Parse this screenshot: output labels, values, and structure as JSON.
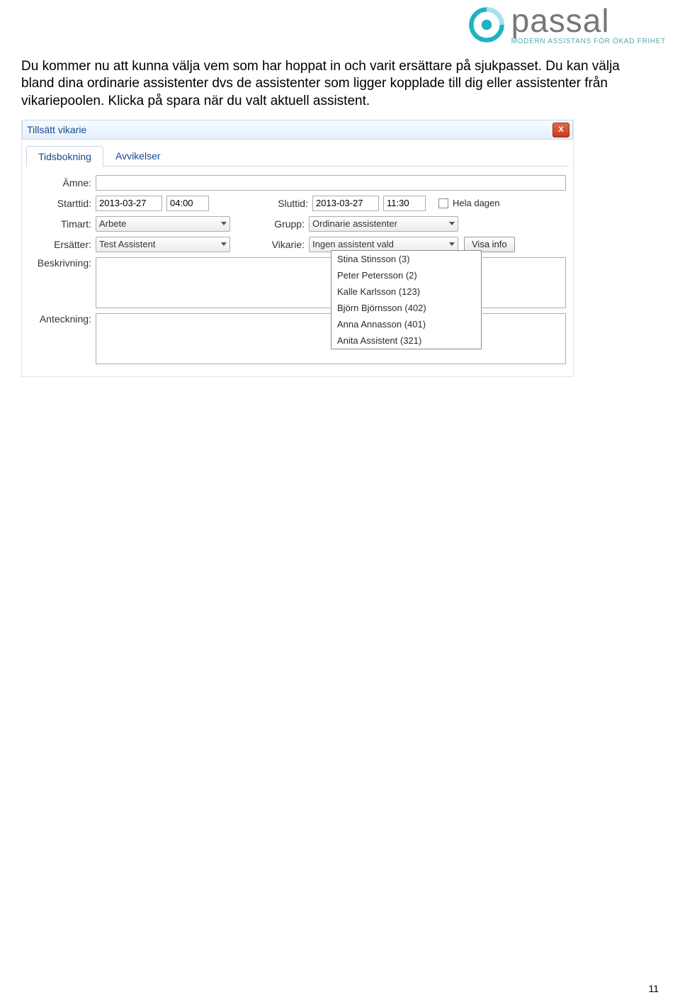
{
  "brand": {
    "name": "passal",
    "tagline": "MODERN ASSISTANS FÖR ÖKAD FRIHET"
  },
  "paragraph": "Du kommer nu att kunna välja vem som har hoppat in och varit ersättare på sjukpasset. Du kan välja bland dina ordinarie assistenter dvs de assistenter som ligger kopplade till dig eller assistenter från vikariepoolen. Klicka på spara när du valt aktuell assistent.",
  "dialog": {
    "title": "Tillsätt vikarie",
    "close_glyph": "X",
    "tabs": {
      "tidsbokning": "Tidsbokning",
      "avvikelser": "Avvikelser"
    },
    "labels": {
      "amne": "Ämne:",
      "starttid": "Starttid:",
      "sluttid": "Sluttid:",
      "hela_dagen": "Hela dagen",
      "timart": "Timart:",
      "grupp": "Grupp:",
      "ersatter": "Ersätter:",
      "vikarie": "Vikarie:",
      "visa_info": "Visa info",
      "beskrivning": "Beskrivning:",
      "anteckning": "Anteckning:"
    },
    "values": {
      "amne": "",
      "start_date": "2013-03-27",
      "start_time": "04:00",
      "end_date": "2013-03-27",
      "end_time": "11:30",
      "timart": "Arbete",
      "grupp": "Ordinarie assistenter",
      "ersatter": "Test Assistent",
      "vikarie_selected": "Ingen assistent vald"
    },
    "vikarie_options": [
      "Stina Stinsson (3)",
      "Peter Petersson (2)",
      "Kalle Karlsson (123)",
      "Björn Björnsson (402)",
      "Anna Annasson (401)",
      "Anita Assistent (321)"
    ]
  },
  "page_number": "11"
}
